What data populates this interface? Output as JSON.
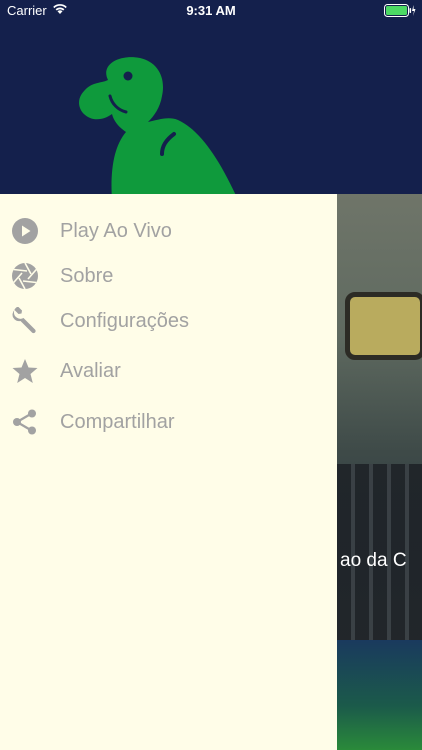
{
  "status_bar": {
    "carrier": "Carrier",
    "time": "9:31 AM"
  },
  "drawer": {
    "menu": [
      {
        "label": "Play Ao Vivo",
        "icon": "play-icon"
      },
      {
        "label": "Sobre",
        "icon": "aperture-icon"
      },
      {
        "label": "Configurações",
        "icon": "wrench-icon"
      },
      {
        "label": "Avaliar",
        "icon": "star-icon"
      },
      {
        "label": "Compartilhar",
        "icon": "share-icon"
      }
    ]
  },
  "background": {
    "caption": "ao da C"
  },
  "colors": {
    "header_bg": "#14204c",
    "menu_bg": "#fffde8",
    "logo_green": "#0f9a3c",
    "menu_text": "#a2a2a2"
  }
}
